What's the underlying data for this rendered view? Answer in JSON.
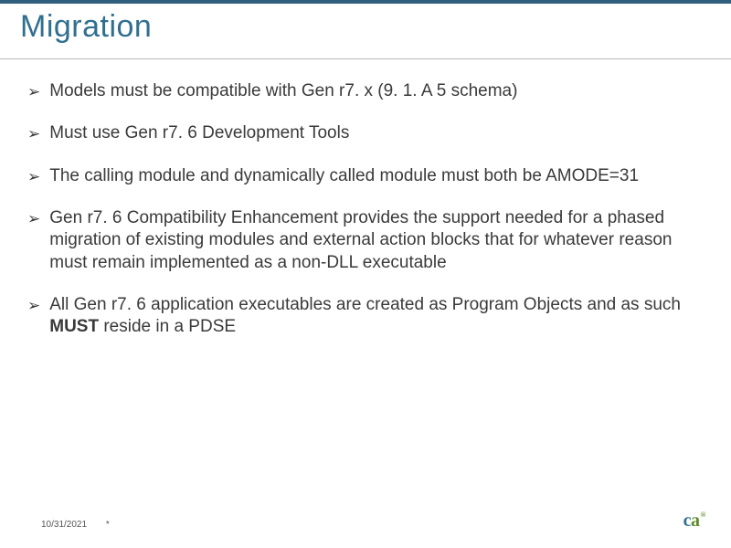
{
  "title": "Migration",
  "bullets": [
    {
      "text": "Models must be compatible with Gen r7. x (9. 1. A 5 schema)"
    },
    {
      "text": "Must use Gen r7. 6 Development Tools"
    },
    {
      "text": "The calling module and dynamically called module must both be AMODE=31"
    },
    {
      "text": "Gen r7. 6 Compatibility Enhancement provides the support needed for a phased migration of existing modules and external action blocks that for whatever reason must remain implemented as a non-DLL executable"
    },
    {
      "html": "All Gen r7. 6 application executables are created as Program Objects and as such <span class=\"bold\">MUST</span> reside in a PDSE"
    }
  ],
  "footer": {
    "date": "10/31/2021",
    "marker": "*"
  },
  "logo": {
    "c": "c",
    "a": "a",
    "r": "®"
  },
  "bullet_glyph": "➢"
}
